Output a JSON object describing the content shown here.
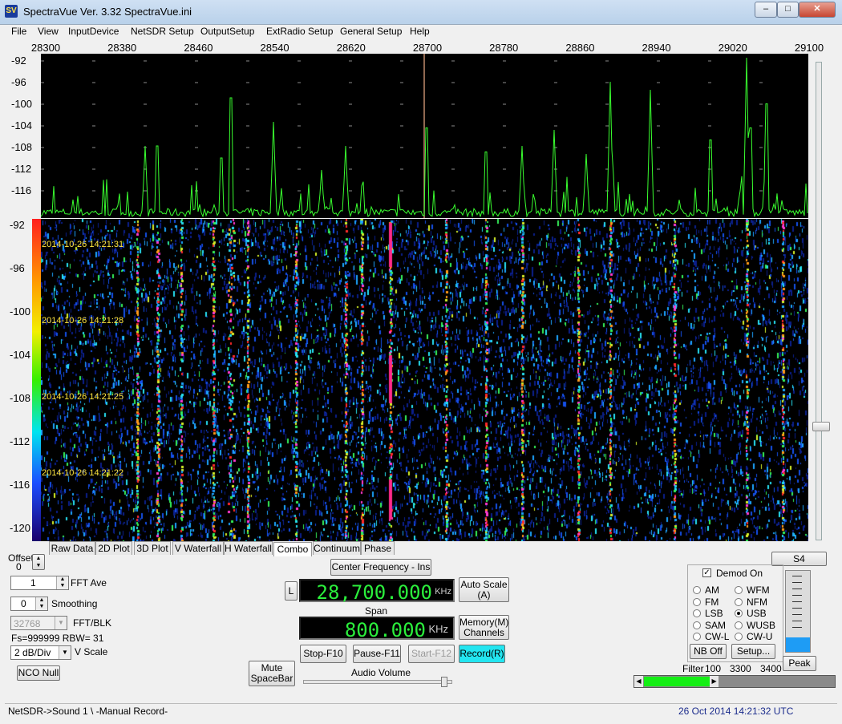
{
  "window": {
    "title": "SpectraVue Ver. 3.32   SpectraVue.ini",
    "icon": "SV"
  },
  "menu": [
    {
      "label": "File"
    },
    {
      "label": "View"
    },
    {
      "label": "InputDevice"
    },
    {
      "label": "NetSDR Setup"
    },
    {
      "label": "OutputSetup"
    },
    {
      "label": "ExtRadio Setup"
    },
    {
      "label": "General Setup"
    },
    {
      "label": "Help"
    }
  ],
  "spectrum": {
    "freq_ticks": [
      "28300",
      "28380",
      "28460",
      "28540",
      "28620",
      "28700",
      "28780",
      "28860",
      "28940",
      "29020",
      "29100"
    ],
    "db_ticks": [
      "-92",
      "-96",
      "-100",
      "-104",
      "-108",
      "-112",
      "-116"
    ],
    "trace_color": "#39ff2f",
    "background": "#000000",
    "grid_color": "#ffffff"
  },
  "waterfall": {
    "db_ticks": [
      "-92",
      "-96",
      "-100",
      "-104",
      "-108",
      "-112",
      "-116",
      "-120"
    ],
    "timestamps": [
      "2014-10-26 14:21:31",
      "2014-10-26 14:21:28",
      "2014-10-26 14:21:25",
      "2014-10-26 14:21:22"
    ]
  },
  "tabs": [
    {
      "label": "Raw Data"
    },
    {
      "label": "2D Plot"
    },
    {
      "label": "3D Plot"
    },
    {
      "label": "V Waterfall"
    },
    {
      "label": "H Waterfall"
    },
    {
      "label": "Combo",
      "active": true
    },
    {
      "label": "Continuum"
    },
    {
      "label": "Phase"
    }
  ],
  "controls": {
    "offset_label": "Offset",
    "offset_value": "0",
    "fft_ave_value": "1",
    "fft_ave_label": "FFT Ave",
    "smoothing_value": "0",
    "smoothing_label": "Smoothing",
    "fft_blk_value": "32768",
    "fft_blk_label": "FFT/BLK",
    "fs_text": "Fs=999999 RBW= 31",
    "vscale_value": "2 dB/Div",
    "vscale_label": "V Scale",
    "nco_null": "NCO Null",
    "center_freq_button": "Center Frequency - Ins",
    "lock_button": "L",
    "center_freq_value": "28,700.000",
    "center_freq_unit": "KHz",
    "auto_scale": "Auto Scale",
    "auto_scale_key": "(A)",
    "span_label": "Span",
    "span_value": "800.000",
    "span_unit": "KHz",
    "memory": "Memory(M)",
    "channels": "Channels",
    "mute": "Mute",
    "mute_key": "SpaceBar",
    "stop": "Stop-F10",
    "pause": "Pause-F11",
    "start": "Start-F12",
    "record": "Record(R)",
    "audio_volume": "Audio Volume",
    "audio_volume_level": 0.95,
    "record_color": "#23e5f0"
  },
  "demod": {
    "s_meter": "S4",
    "s_meter_level": 0.18,
    "demod_on_label": "Demod On",
    "demod_on": true,
    "modes_left": [
      "AM",
      "FM",
      "LSB",
      "SAM",
      "CW-L"
    ],
    "modes_right": [
      "WFM",
      "NFM",
      "USB",
      "WUSB",
      "CW-U"
    ],
    "selected": "USB",
    "nb_off": "NB Off",
    "setup": "Setup...",
    "peak": "Peak",
    "filter_label": "Filter",
    "filter_values": [
      "100",
      "3300",
      "3400"
    ],
    "filter_slider_fill": 0.36
  },
  "status": {
    "left": "NetSDR->Sound 1  \\ -Manual Record-",
    "right": "26 Oct 2014  14:21:32 UTC"
  }
}
